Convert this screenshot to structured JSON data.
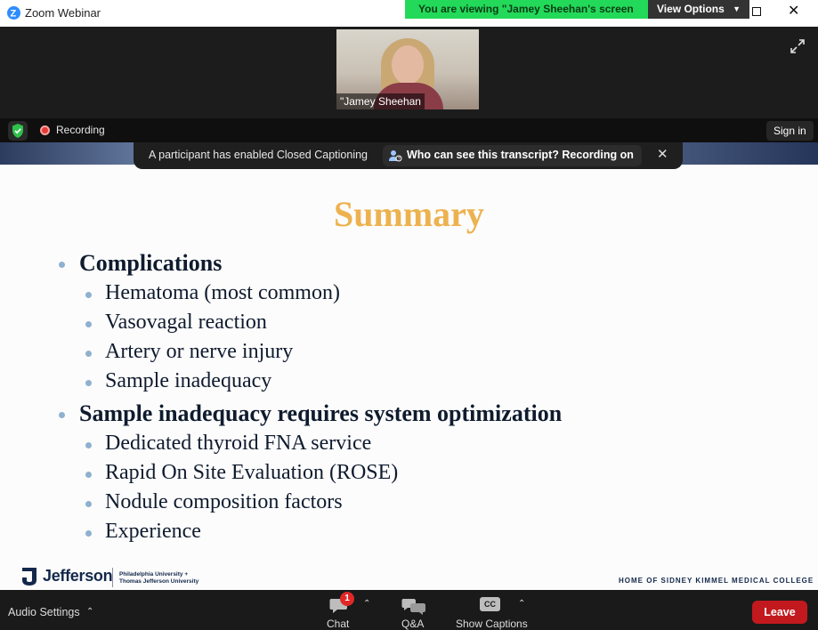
{
  "window": {
    "title": "Zoom Webinar",
    "viewing_banner": "You are viewing \"Jamey  Sheehan's screen",
    "view_options": "View Options"
  },
  "video": {
    "participant_name": "\"Jamey  Sheehan"
  },
  "status": {
    "recording_label": "Recording",
    "sign_in": "Sign in"
  },
  "captions": {
    "notice": "A participant has enabled Closed Captioning",
    "transcript_button": "Who can see this transcript? Recording on"
  },
  "slide": {
    "title": "Summary",
    "bullets": [
      {
        "text": "Complications",
        "sub": [
          "Hematoma (most common)",
          "Vasovagal reaction",
          "Artery or nerve injury",
          "Sample inadequacy"
        ]
      },
      {
        "text": "Sample inadequacy requires system optimization",
        "sub": [
          "Dedicated thyroid FNA service",
          "Rapid On Site Evaluation (ROSE)",
          "Nodule composition factors",
          "Experience"
        ]
      }
    ],
    "footer": {
      "brand": "Jefferson",
      "sub_line1": "Philadelphia University +",
      "sub_line2": "Thomas Jefferson University",
      "right_text": "HOME OF SIDNEY KIMMEL MEDICAL COLLEGE"
    }
  },
  "toolbar": {
    "audio_settings": "Audio Settings",
    "chat_label": "Chat",
    "chat_badge": "1",
    "qa_label": "Q&A",
    "captions_label": "Show Captions",
    "cc_icon_text": "CC",
    "leave_label": "Leave"
  },
  "colors": {
    "banner_green": "#23d959",
    "slide_title": "#edb24f",
    "slide_text": "#0f1b2e",
    "bullet_dot": "#8fb1cf",
    "leave_red": "#c2191f",
    "zoom_blue": "#2d8cff"
  }
}
